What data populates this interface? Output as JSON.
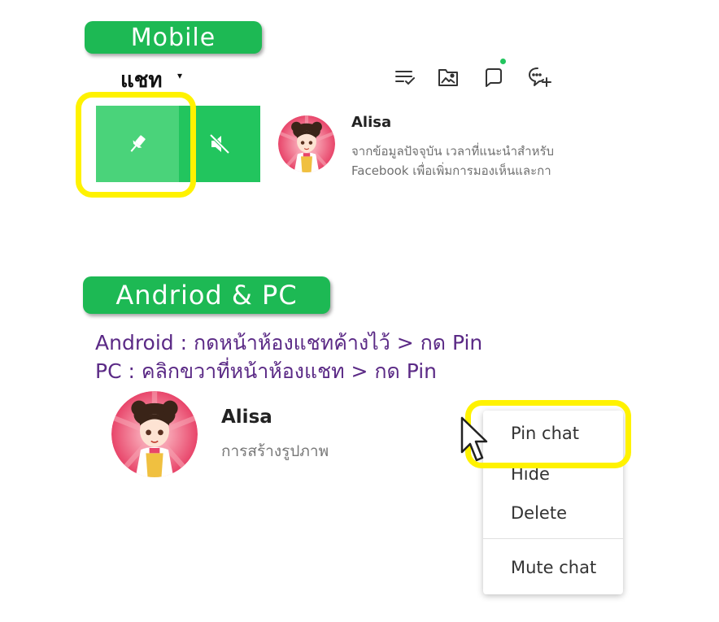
{
  "labels": {
    "mobile": "Mobile",
    "android_pc": "Andriod & PC"
  },
  "mobile_header": {
    "title": "แชท",
    "caret": "▾",
    "icons": [
      "checklist-icon",
      "photo-folder-icon",
      "square-chat-icon",
      "new-chat-icon"
    ],
    "notification_color": "#22c55e"
  },
  "swipe_actions": {
    "pin_icon": "pin-icon",
    "mute_icon": "mute-icon",
    "pin_color": "#4ad37a",
    "mute_color": "#22c55e"
  },
  "mobile_chat": {
    "name": "Alisa",
    "preview_line1": "จากข้อมูลปัจจุบัน เวลาที่แนะนำสำหรับ",
    "preview_line2": "Facebook เพื่อเพิ่มการมองเห็นและกา"
  },
  "instructions": {
    "android": "Android : กดหน้าห้องแชทค้างไว้ > กด Pin",
    "pc": "PC : คลิกขวาที่หน้าห้องแชท > กด Pin"
  },
  "pc_chat": {
    "name": "Alisa",
    "preview": "การสร้างรูปภาพ"
  },
  "context_menu": {
    "pin": "Pin chat",
    "hide": "Hide",
    "delete": "Delete",
    "mute": "Mute chat"
  },
  "colors": {
    "badge": "#1db954",
    "highlight": "#fff200",
    "instruction_text": "#5b2a86"
  }
}
